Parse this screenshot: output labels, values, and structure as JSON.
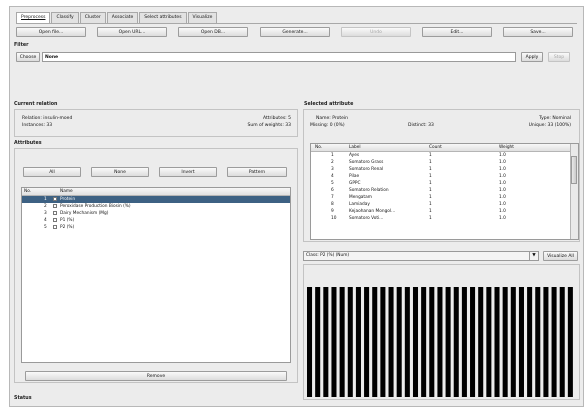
{
  "window": {
    "tabs": [
      "Preprocess",
      "Classify",
      "Cluster",
      "Associate",
      "Select attributes",
      "Visualize"
    ],
    "active_tab_index": 0
  },
  "toolbar": {
    "open_file": "Open file...",
    "open_url": "Open URL...",
    "open_db": "Open DB...",
    "generate": "Generate...",
    "undo": "Undo",
    "edit": "Edit...",
    "save": "Save..."
  },
  "filter": {
    "title": "Filter",
    "choose_label": "Choose",
    "value": "None",
    "apply_label": "Apply",
    "stop_label": "Stop"
  },
  "current_relation": {
    "title": "Current relation",
    "relation_label": "Relation: insulin-moed",
    "instances_label": "Instances: 33",
    "attributes_label": "Attributes: 5",
    "sum_weights_label": "Sum of weights: 33"
  },
  "attributes": {
    "title": "Attributes",
    "buttons": {
      "all": "All",
      "none": "None",
      "invert": "Invert",
      "pattern": "Pattern"
    },
    "columns": {
      "no": "No.",
      "name": "Name"
    },
    "rows": [
      {
        "no": "1",
        "name": "Protein",
        "checked": false,
        "selected": true
      },
      {
        "no": "2",
        "name": "Peroxidase Production Biosin (%)",
        "checked": false,
        "selected": false
      },
      {
        "no": "3",
        "name": "Dairy Mechanism (Mg)",
        "checked": false,
        "selected": false
      },
      {
        "no": "4",
        "name": "P1 (%)",
        "checked": false,
        "selected": false
      },
      {
        "no": "5",
        "name": "P2 (%)",
        "checked": false,
        "selected": false
      }
    ],
    "remove_label": "Remove"
  },
  "selected_attribute": {
    "title": "Selected attribute",
    "name_label": "Name: Protein",
    "missing_label": "Missing: 0 (0%)",
    "distinct_label": "Distinct: 33",
    "type_label": "Type: Nominal",
    "unique_label": "Unique: 33 (100%)",
    "columns": {
      "no": "No.",
      "label": "Label",
      "count": "Count",
      "weight": "Weight"
    },
    "rows": [
      {
        "no": "1",
        "label": "Ayes",
        "count": "1",
        "weight": "1.0"
      },
      {
        "no": "2",
        "label": "Somatoro Grass",
        "count": "1",
        "weight": "1.0"
      },
      {
        "no": "3",
        "label": "Somatoro Renal",
        "count": "1",
        "weight": "1.0"
      },
      {
        "no": "4",
        "label": "Pilae",
        "count": "1",
        "weight": "1.0"
      },
      {
        "no": "5",
        "label": "GPPC",
        "count": "1",
        "weight": "1.0"
      },
      {
        "no": "6",
        "label": "Somatoro Relation",
        "count": "1",
        "weight": "1.0"
      },
      {
        "no": "7",
        "label": "Mengatam",
        "count": "1",
        "weight": "1.0"
      },
      {
        "no": "8",
        "label": "Lamiaday",
        "count": "1",
        "weight": "1.0"
      },
      {
        "no": "9",
        "label": "Kejaohanan Mongol...",
        "count": "1",
        "weight": "1.0"
      },
      {
        "no": "10",
        "label": "Somatoro Voti...",
        "count": "1",
        "weight": "1.0"
      }
    ]
  },
  "visualization": {
    "class_select": "Class: P2 (%) (Num)",
    "visualize_all_label": "Visualize All",
    "bar_count": 33,
    "bar_color": "#000000"
  },
  "status": {
    "title": "Status"
  }
}
